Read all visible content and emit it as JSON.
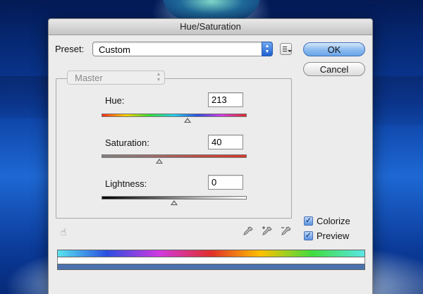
{
  "window": {
    "title": "Hue/Saturation"
  },
  "preset": {
    "label": "Preset:",
    "value": "Custom"
  },
  "buttons": {
    "ok": "OK",
    "cancel": "Cancel"
  },
  "channel": {
    "value": "Master"
  },
  "hue": {
    "label": "Hue:",
    "value": "213",
    "fraction": 0.59
  },
  "saturation": {
    "label": "Saturation:",
    "value": "40",
    "fraction": 0.4
  },
  "lightness": {
    "label": "Lightness:",
    "value": "0",
    "fraction": 0.5
  },
  "options": {
    "colorize": "Colorize",
    "preview": "Preview",
    "colorize_checked": true,
    "preview_checked": true
  },
  "colors": {
    "default_button": "#6aa4e8",
    "colorize_bar": "#4b72ad"
  }
}
